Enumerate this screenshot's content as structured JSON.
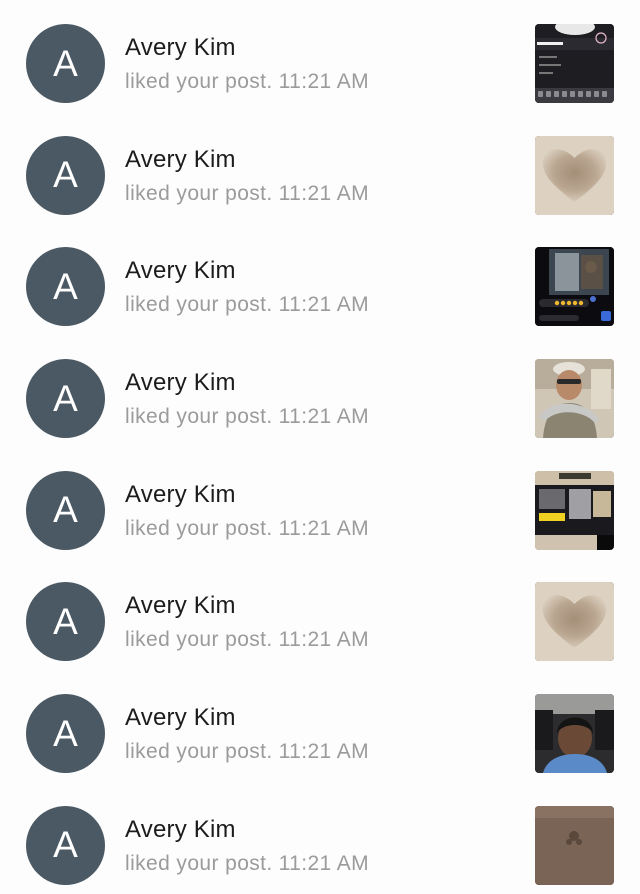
{
  "notifications": [
    {
      "avatar_letter": "A",
      "name": "Avery Kim",
      "action": "liked your post.",
      "time": "11:21 AM",
      "thumb": "dark-screenshot-thumbnail"
    },
    {
      "avatar_letter": "A",
      "name": "Avery Kim",
      "action": "liked your post.",
      "time": "11:21 AM",
      "thumb": "heart-thumbnail"
    },
    {
      "avatar_letter": "A",
      "name": "Avery Kim",
      "action": "liked your post.",
      "time": "11:21 AM",
      "thumb": "video-call-thumbnail"
    },
    {
      "avatar_letter": "A",
      "name": "Avery Kim",
      "action": "liked your post.",
      "time": "11:21 AM",
      "thumb": "person-photo-thumbnail"
    },
    {
      "avatar_letter": "A",
      "name": "Avery Kim",
      "action": "liked your post.",
      "time": "11:21 AM",
      "thumb": "collage-thumbnail"
    },
    {
      "avatar_letter": "A",
      "name": "Avery Kim",
      "action": "liked your post.",
      "time": "11:21 AM",
      "thumb": "heart-thumbnail"
    },
    {
      "avatar_letter": "A",
      "name": "Avery Kim",
      "action": "liked your post.",
      "time": "11:21 AM",
      "thumb": "car-selfie-thumbnail"
    },
    {
      "avatar_letter": "A",
      "name": "Avery Kim",
      "action": "liked your post.",
      "time": "11:21 AM",
      "thumb": "brown-photo-thumbnail"
    }
  ],
  "colors": {
    "avatar_bg": "#4b5964",
    "name_text": "#1c1c1c",
    "secondary_text": "#9b9b9b",
    "background": "#fdfdfd"
  }
}
